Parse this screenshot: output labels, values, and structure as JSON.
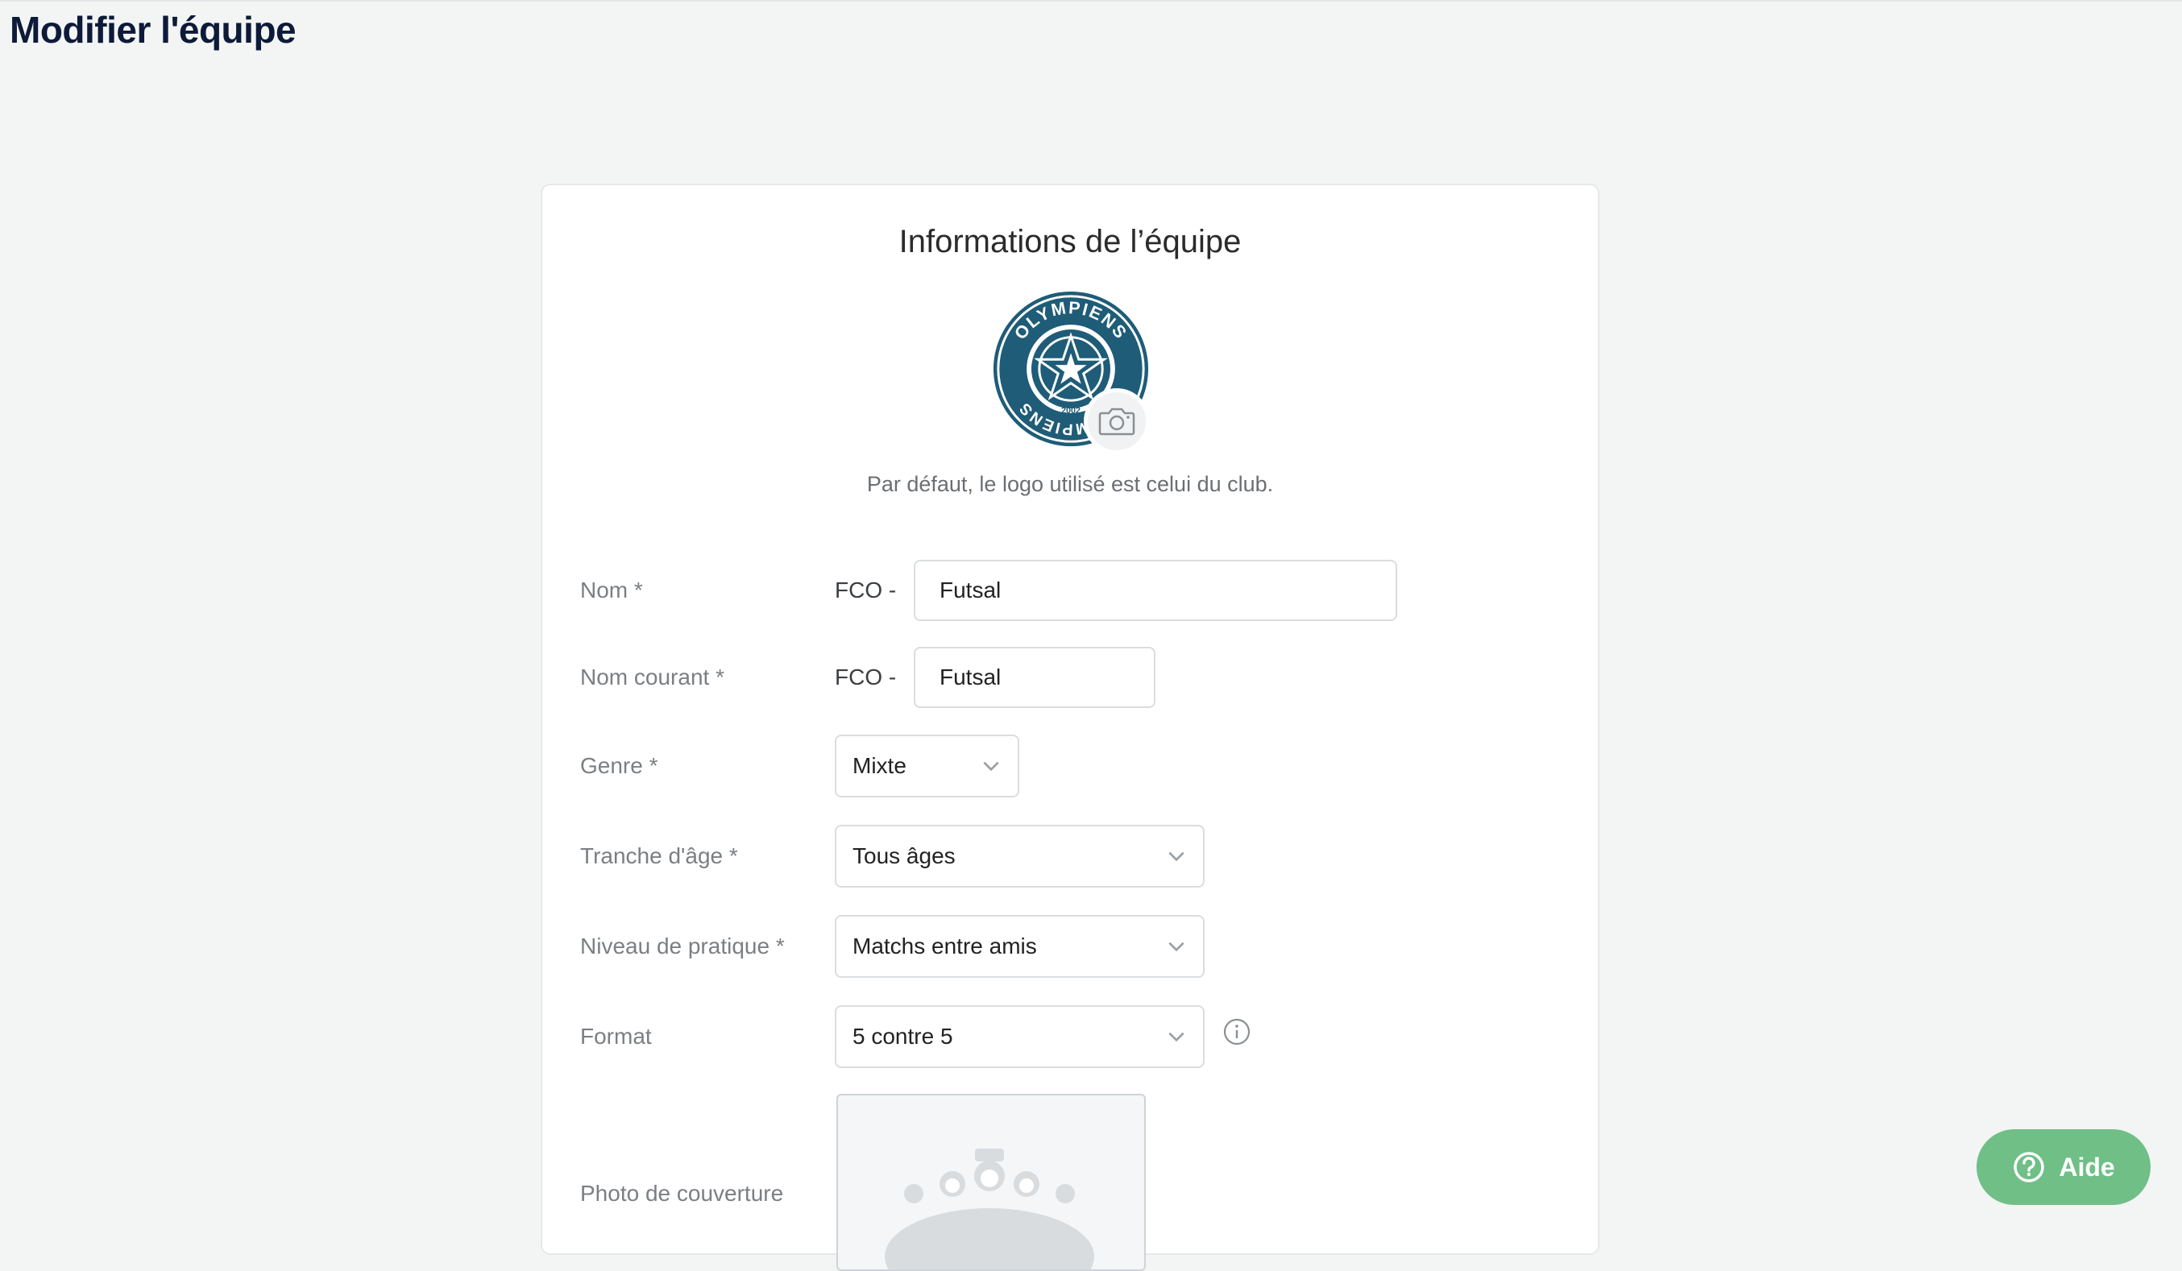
{
  "page": {
    "title": "Modifier l'équipe"
  },
  "card": {
    "title": "Informations de l’équipe",
    "logo_hint": "Par défaut, le logo utilisé est celui du club.",
    "logo_text": {
      "top": "OLYMPIENS",
      "bottom": "OLYMPIENS",
      "year": "2002"
    }
  },
  "form": {
    "nom": {
      "label": "Nom *",
      "prefix": "FCO -",
      "value": "Futsal"
    },
    "nom_courant": {
      "label": "Nom courant *",
      "prefix": "FCO -",
      "value": "Futsal"
    },
    "genre": {
      "label": "Genre *",
      "value": "Mixte"
    },
    "tranche_age": {
      "label": "Tranche d'âge *",
      "value": "Tous âges"
    },
    "niveau": {
      "label": "Niveau de pratique *",
      "value": "Matchs entre amis"
    },
    "format": {
      "label": "Format",
      "value": "5 contre 5"
    },
    "cover": {
      "label": "Photo de couverture"
    }
  },
  "help": {
    "label": "Aide"
  },
  "colors": {
    "accent": "#6fbf86",
    "title": "#0d1a38",
    "logo_primary": "#1e5c78"
  },
  "icons": [
    "camera-icon",
    "chevron-down-icon",
    "info-icon",
    "question-circle-icon",
    "team-placeholder-icon"
  ]
}
